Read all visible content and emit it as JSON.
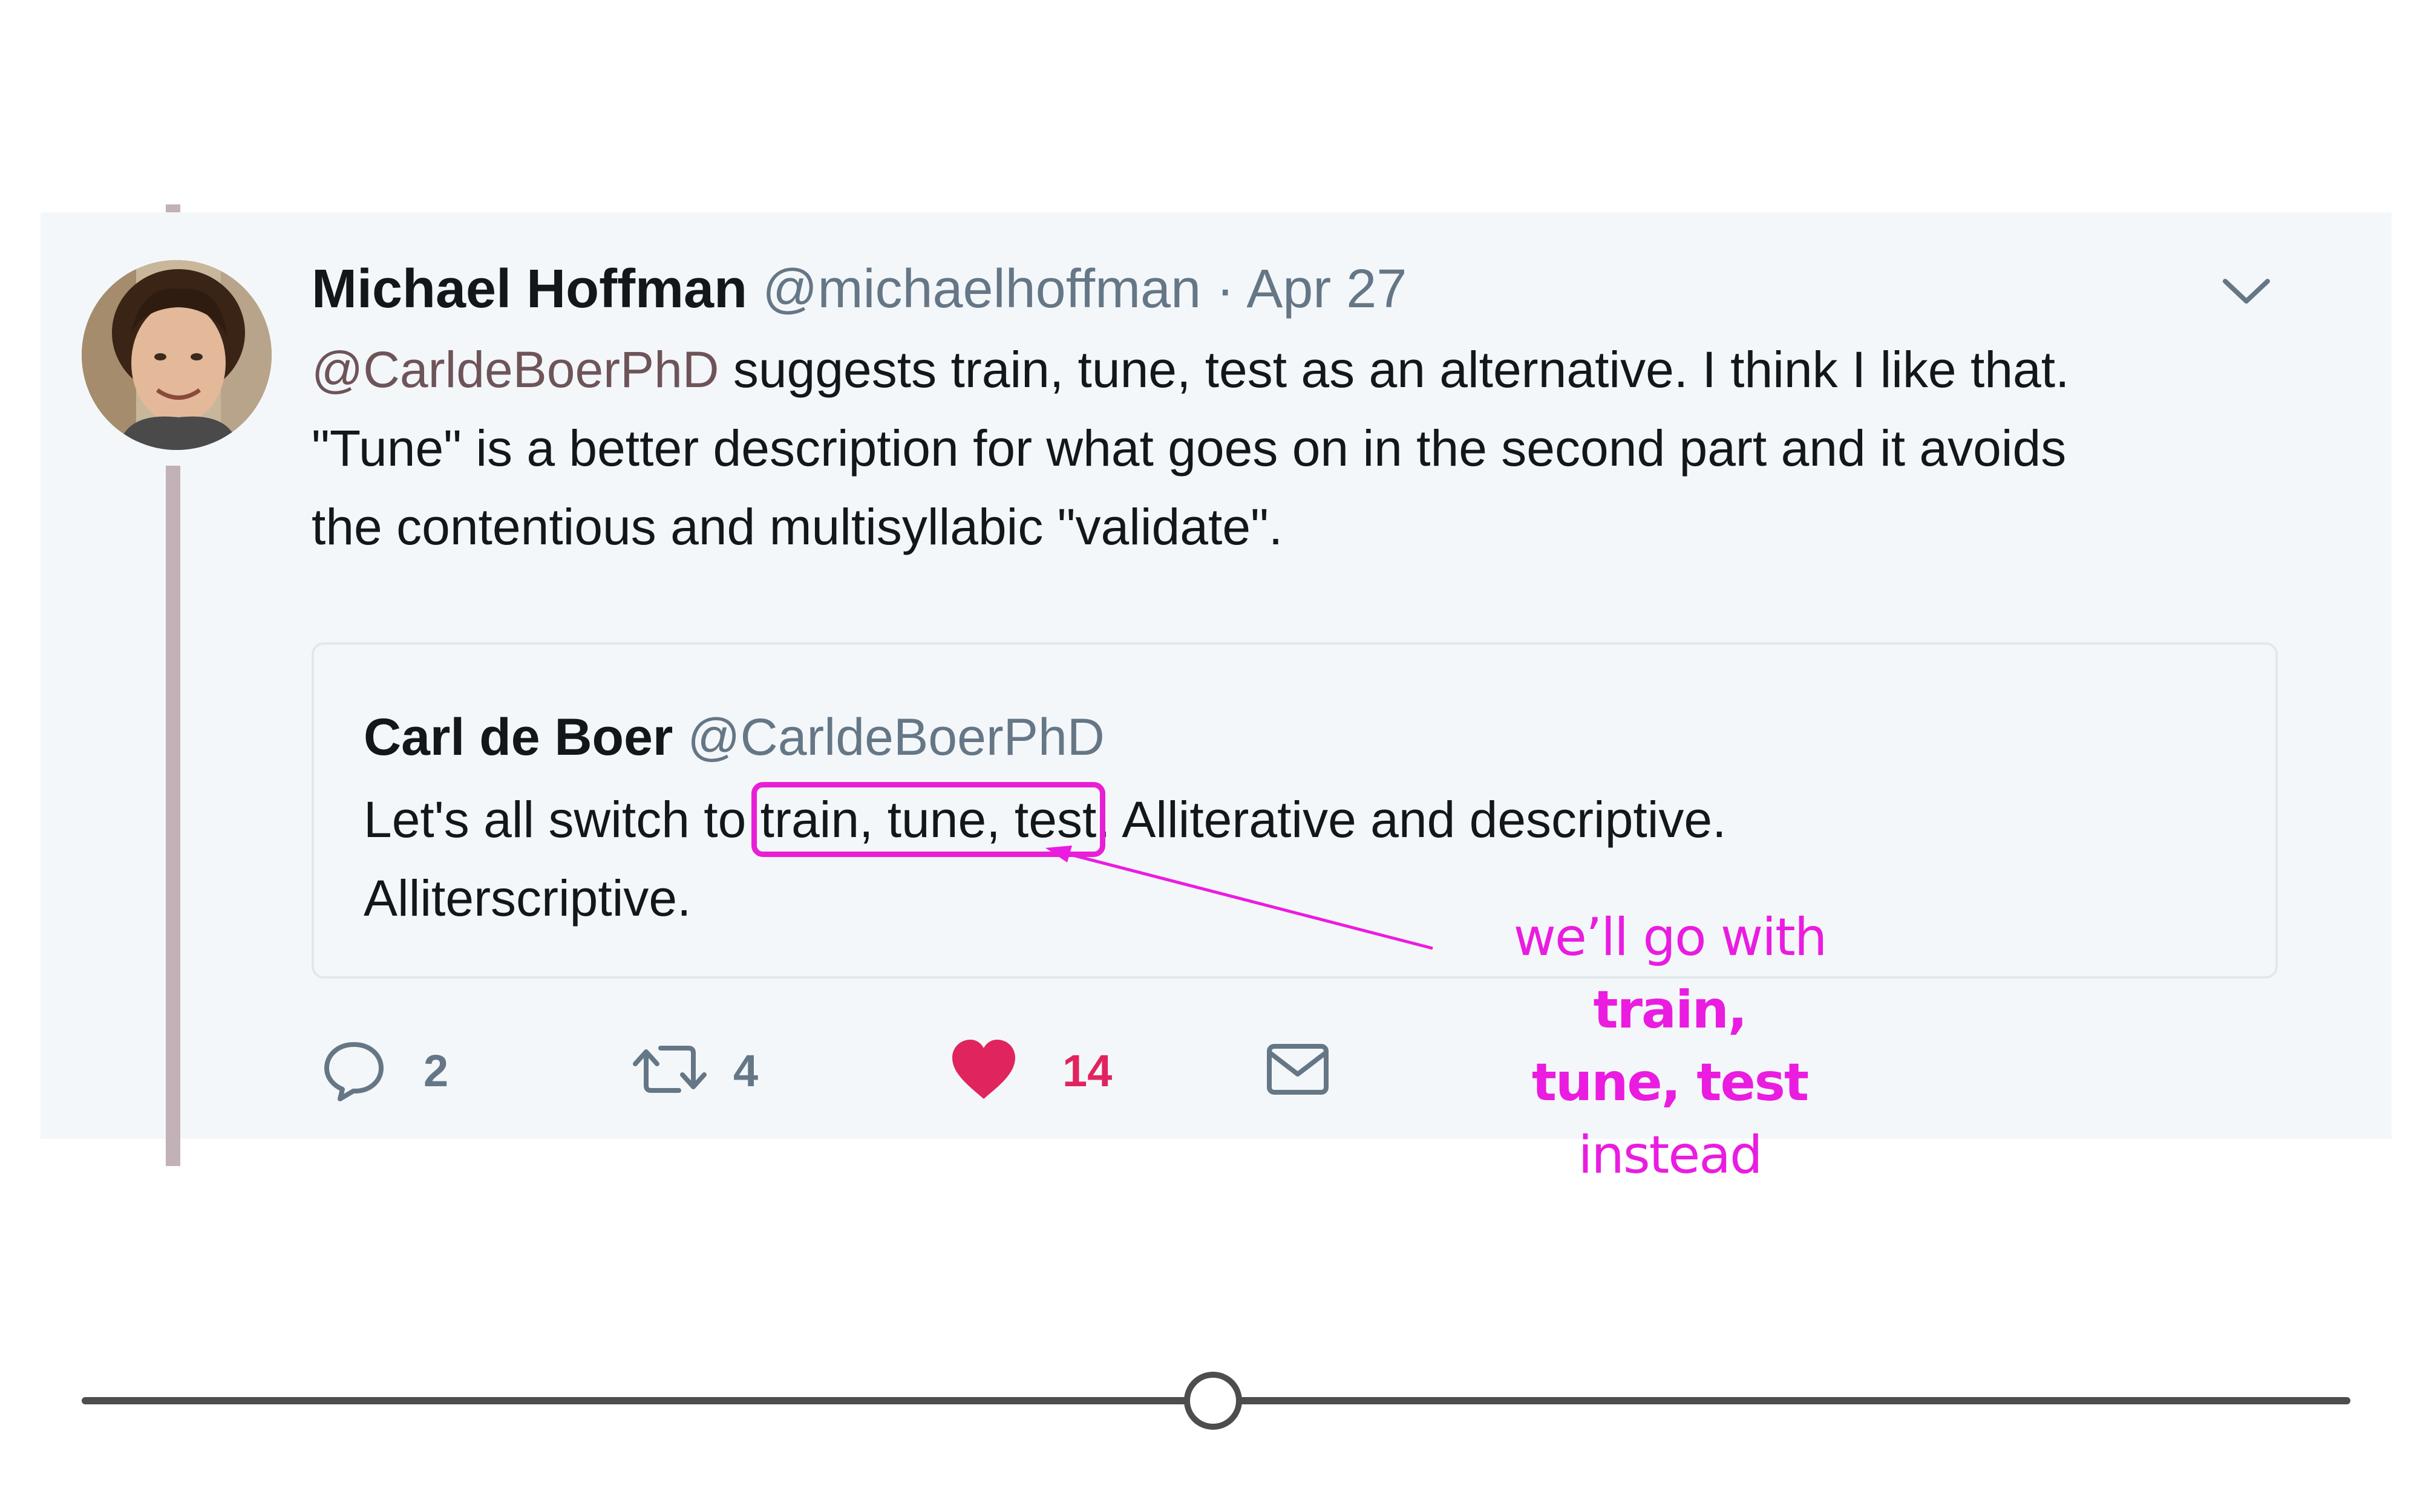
{
  "tweet": {
    "author_name": "Michael Hoffman",
    "author_handle": "@michaelhoffman",
    "separator": "·",
    "date": "Apr 27",
    "mention": "@CarldeBoerPhD",
    "text_line1_rest": " suggests train, tune, test as an alternative. I think I like that.",
    "text_line2": "\"Tune\" is a better description for what goes on in the second part and it avoids",
    "text_line3": "the contentious and multisyllabic \"validate\"."
  },
  "quoted_tweet": {
    "name": "Carl de Boer",
    "handle": "@CarldeBoerPhD",
    "text_before": "Let's all switch to ",
    "highlighted": "train, tune, test",
    "text_after": ". Alliterative and descriptive.",
    "text_line2": "Alliterscriptive."
  },
  "annotation": {
    "line1_plain": "we’ll go with ",
    "line1_bold": "train,",
    "line2_bold": "tune, test",
    "line2_plain": " instead",
    "color": "#ea1ce0"
  },
  "actions": {
    "reply_icon": "reply-icon",
    "reply_count": "2",
    "retweet_icon": "retweet-icon",
    "retweet_count": "4",
    "like_icon": "heart-icon",
    "like_count": "14",
    "dm_icon": "envelope-icon"
  },
  "colors": {
    "card_background": "#f4f7fa",
    "thread_line": "#c2b1b7",
    "mention": "#6e5459",
    "muted": "#657786",
    "like": "#e0245e"
  }
}
